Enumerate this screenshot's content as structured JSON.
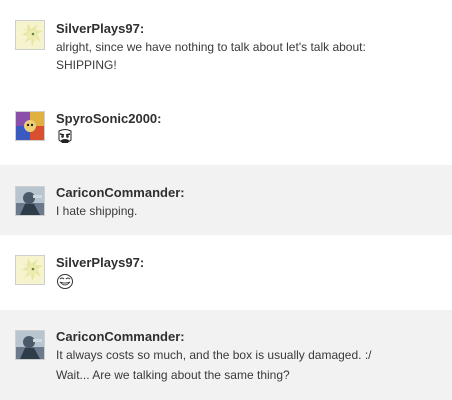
{
  "messages": [
    {
      "author": "SilverPlays97:",
      "avatar": "silver-hedgehog-avatar",
      "lines": [
        "alright, since we have nothing to talk about let's talk about:",
        "SHIPPING!"
      ]
    },
    {
      "author": "SpyroSonic2000:",
      "avatar": "spyro-sonic-avatar",
      "emote": "rage-face-emote"
    },
    {
      "author": "CariconCommander:",
      "avatar": "commander-avatar",
      "lines": [
        "I hate shipping."
      ]
    },
    {
      "author": "SilverPlays97:",
      "avatar": "silver-hedgehog-avatar",
      "emote": "troll-face-emote"
    },
    {
      "author": "CariconCommander:",
      "avatar": "commander-avatar",
      "lines": [
        "It always costs so much, and the box is usually damaged. :/",
        "Wait... Are we talking about the same thing?"
      ]
    }
  ],
  "colors": {
    "row_alt": "#f2f2f2",
    "row_default": "#ffffff",
    "author_text": "#2f2f2f",
    "body_text": "#3a3a3a"
  }
}
